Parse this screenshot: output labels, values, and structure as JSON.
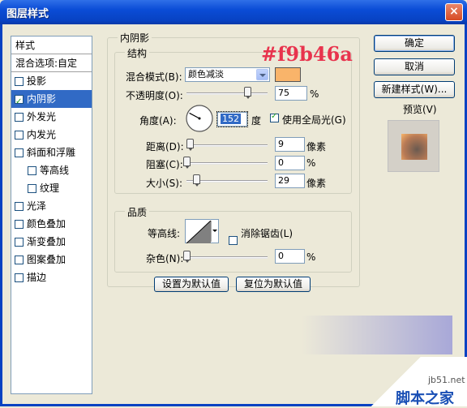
{
  "window": {
    "title": "图层样式",
    "close_glyph": "×"
  },
  "style_list": {
    "header": "样式",
    "blend_options": "混合选项:自定",
    "items": [
      {
        "label": "投影",
        "checked": false,
        "sub": false
      },
      {
        "label": "内阴影",
        "checked": true,
        "sub": false,
        "selected": true
      },
      {
        "label": "外发光",
        "checked": false,
        "sub": false
      },
      {
        "label": "内发光",
        "checked": false,
        "sub": false
      },
      {
        "label": "斜面和浮雕",
        "checked": false,
        "sub": false
      },
      {
        "label": "等高线",
        "checked": false,
        "sub": true
      },
      {
        "label": "纹理",
        "checked": false,
        "sub": true
      },
      {
        "label": "光泽",
        "checked": false,
        "sub": false
      },
      {
        "label": "颜色叠加",
        "checked": false,
        "sub": false
      },
      {
        "label": "渐变叠加",
        "checked": false,
        "sub": false
      },
      {
        "label": "图案叠加",
        "checked": false,
        "sub": false
      },
      {
        "label": "描边",
        "checked": false,
        "sub": false
      }
    ]
  },
  "inner_shadow": {
    "group_label": "内阴影",
    "structure_label": "结构",
    "color_annotation": "#f9b46a",
    "shadow_color": "#f9b46a",
    "blend_mode_label": "混合模式(B):",
    "blend_mode_value": "颜色减淡",
    "opacity_label": "不透明度(O):",
    "opacity_value": "75",
    "opacity_fraction": 0.75,
    "percent": "%",
    "angle_label": "角度(A):",
    "angle_value": "152",
    "angle_unit": "度",
    "global_light_label": "使用全局光(G)",
    "distance_label": "距离(D):",
    "distance_value": "9",
    "distance_fraction": 0.04,
    "choke_label": "阻塞(C):",
    "choke_value": "0",
    "choke_fraction": 0,
    "size_label": "大小(S):",
    "size_value": "29",
    "size_fraction": 0.12,
    "pixel_unit": "像素",
    "quality_label": "品质",
    "contour_label": "等高线:",
    "anti_alias_label": "消除锯齿(L)",
    "noise_label": "杂色(N):",
    "noise_value": "0",
    "noise_fraction": 0,
    "set_default_button": "设置为默认值",
    "reset_default_button": "复位为默认值"
  },
  "actions": {
    "ok": "确定",
    "cancel": "取消",
    "new_style": "新建样式(W)...",
    "preview_label": "预览(V)",
    "preview_checked": true
  },
  "watermark": {
    "site": "jb51.net",
    "name": "脚本之家"
  }
}
